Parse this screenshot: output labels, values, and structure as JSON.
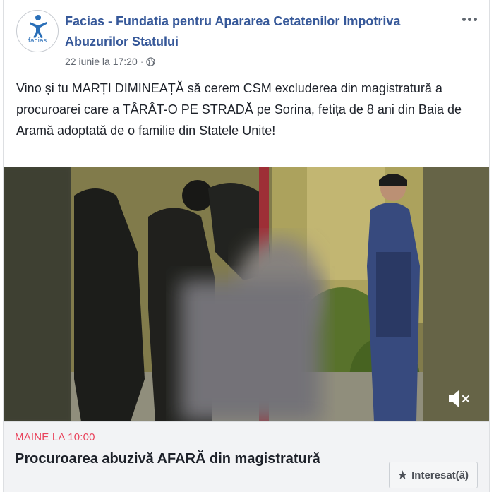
{
  "post": {
    "page_name": "Facias - Fundatia pentru Apararea Cetatenilor Impotriva Abuzurilor Statului",
    "avatar_label": "facias",
    "timestamp": "22 iunie la 17:20",
    "separator": "·",
    "privacy_icon": "globe-icon",
    "more_icon": "more-options-icon",
    "text": "Vino și tu MARȚI DIMINEAȚĂ să cerem CSM excluderea din magistratură a procuroarei care a TÂRÂT-O PE STRADĂ pe Sorina, fetița de 8 ani din Baia de Aramă adoptată de o familie din Statele Unite!"
  },
  "video": {
    "mute_icon": "speaker-muted-icon"
  },
  "event": {
    "date": "MAINE LA 10:00",
    "title": "Procuroarea abuzivă AFARĂ din magistratură",
    "interested_label": "Interesat(ă)",
    "interested_icon": "star-icon"
  },
  "colors": {
    "link": "#365899",
    "event_date": "#e9425b",
    "text": "#1d2129"
  }
}
